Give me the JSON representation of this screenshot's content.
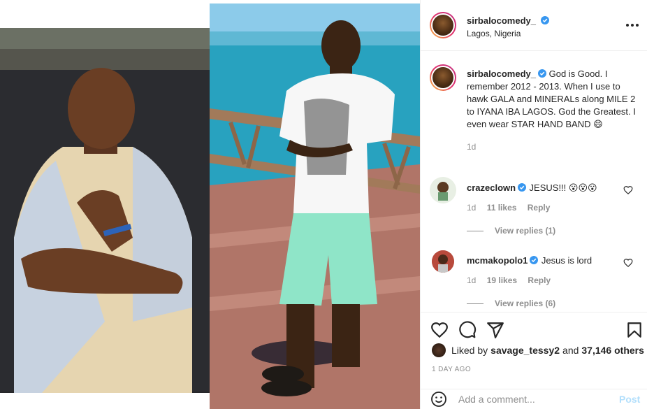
{
  "post": {
    "username": "sirbalocomedy_",
    "location": "Lagos, Nigeria",
    "caption": "God is Good. I remember 2012 - 2013. When I use to hawk GALA and MINERALs along MILE 2 to IYANA IBA LAGOS. God the Greatest. I even wear STAR HAND BAND 😄",
    "caption_age": "1d"
  },
  "comments": [
    {
      "username": "crazeclown",
      "text": "JESUS!!! 😮😮😮",
      "age": "1d",
      "likes": "11 likes",
      "reply_label": "Reply",
      "view_replies": "View replies (1)"
    },
    {
      "username": "mcmakopolo1",
      "text": "Jesus is lord",
      "age": "1d",
      "likes": "19 likes",
      "reply_label": "Reply",
      "view_replies": "View replies (6)"
    }
  ],
  "likes": {
    "prefix": "Liked by",
    "user": "savage_tessy2",
    "conjunction": "and",
    "count": "37,146 others"
  },
  "date": "1 DAY AGO",
  "add_comment": {
    "placeholder": "Add a comment...",
    "post_label": "Post"
  },
  "colors": {
    "verified": "#3897f0",
    "text": "#262626",
    "muted": "#8e8e8e",
    "post_disabled": "#b2dffc"
  }
}
